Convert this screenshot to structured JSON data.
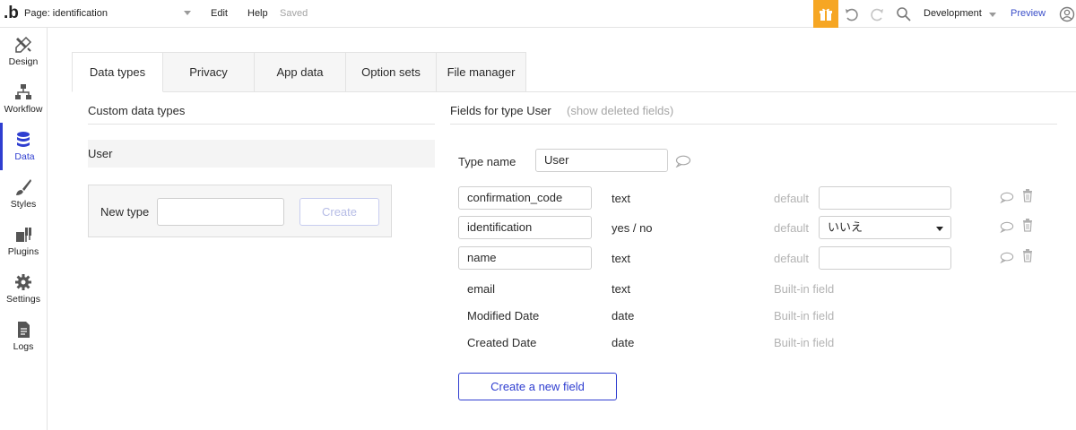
{
  "topbar": {
    "logo": ".b",
    "page_label": "Page: identification",
    "menu": {
      "edit": "Edit",
      "help": "Help",
      "status": "Saved"
    },
    "icons": [
      "gift-icon",
      "undo-icon",
      "redo-icon",
      "search-icon",
      "user-icon"
    ],
    "environment": "Development",
    "preview": "Preview",
    "accent_color": "#f6a623"
  },
  "sidebar": {
    "items": [
      {
        "label": "Design",
        "icon": "design-icon"
      },
      {
        "label": "Workflow",
        "icon": "workflow-icon"
      },
      {
        "label": "Data",
        "icon": "database-icon",
        "active": true
      },
      {
        "label": "Styles",
        "icon": "brush-icon"
      },
      {
        "label": "Plugins",
        "icon": "plug-icon"
      },
      {
        "label": "Settings",
        "icon": "gear-icon"
      },
      {
        "label": "Logs",
        "icon": "document-icon"
      }
    ],
    "active_color": "#2f3ed0"
  },
  "tabs": [
    "Data types",
    "Privacy",
    "App data",
    "Option sets",
    "File manager"
  ],
  "left": {
    "title": "Custom data types",
    "types": [
      "User"
    ],
    "new_type_label": "New type",
    "new_type_value": "",
    "create_label": "Create"
  },
  "right": {
    "title": "Fields for type User",
    "show_deleted": "(show deleted fields)",
    "type_name_label": "Type name",
    "type_name_value": "User",
    "default_label": "default",
    "fields": [
      {
        "name": "confirmation_code",
        "type": "text",
        "default": ""
      },
      {
        "name": "identification",
        "type": "yes / no",
        "default": "いいえ"
      },
      {
        "name": "name",
        "type": "text",
        "default": ""
      }
    ],
    "builtin": [
      {
        "name": "email",
        "type": "text",
        "note": "Built-in field"
      },
      {
        "name": "Modified Date",
        "type": "date",
        "note": "Built-in field"
      },
      {
        "name": "Created Date",
        "type": "date",
        "note": "Built-in field"
      }
    ],
    "create_field_label": "Create a new field"
  }
}
